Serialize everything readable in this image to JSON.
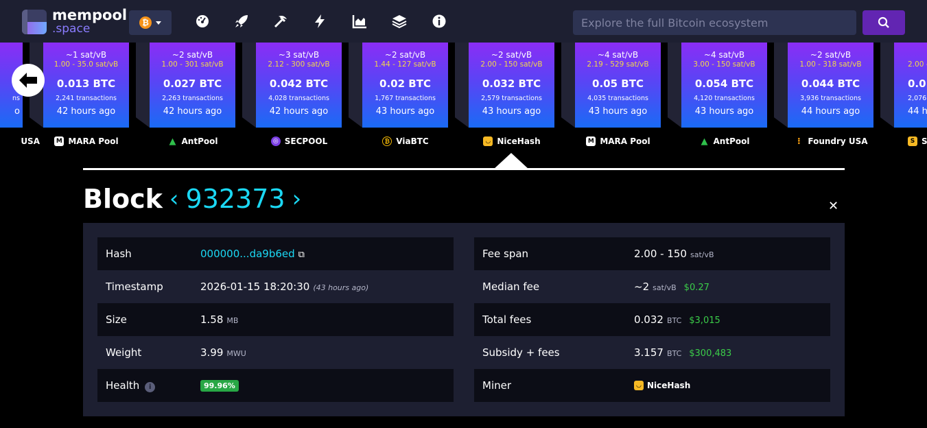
{
  "header": {
    "logo_top": "mempool",
    "logo_bottom": ".space",
    "network_symbol": "₿",
    "search_placeholder": "Explore the full Bitcoin ecosystem",
    "nav_icons": [
      "dashboard-icon",
      "rocket-icon",
      "mining-icon",
      "lightning-icon",
      "graphs-icon",
      "docs-icon",
      "about-icon"
    ]
  },
  "blocks": [
    {
      "fee": "~1 sat/vB",
      "range": "1.00 - 35.0 sat/vB",
      "amount": "0.013 BTC",
      "txs": "2,241 transactions",
      "time": "42 hours ago",
      "pool": "MARA Pool"
    },
    {
      "fee": "~2 sat/vB",
      "range": "1.00 - 301 sat/vB",
      "amount": "0.027 BTC",
      "txs": "2,263 transactions",
      "time": "42 hours ago",
      "pool": "AntPool"
    },
    {
      "fee": "~3 sat/vB",
      "range": "2.12 - 300 sat/vB",
      "amount": "0.042 BTC",
      "txs": "4,028 transactions",
      "time": "42 hours ago",
      "pool": "SECPOOL"
    },
    {
      "fee": "~2 sat/vB",
      "range": "1.44 - 127 sat/vB",
      "amount": "0.02 BTC",
      "txs": "1,767 transactions",
      "time": "43 hours ago",
      "pool": "ViaBTC"
    },
    {
      "fee": "~2 sat/vB",
      "range": "2.00 - 150 sat/vB",
      "amount": "0.032 BTC",
      "txs": "2,579 transactions",
      "time": "43 hours ago",
      "pool": "NiceHash"
    },
    {
      "fee": "~4 sat/vB",
      "range": "2.19 - 529 sat/vB",
      "amount": "0.05 BTC",
      "txs": "4,035 transactions",
      "time": "43 hours ago",
      "pool": "MARA Pool"
    },
    {
      "fee": "~4 sat/vB",
      "range": "3.00 - 150 sat/vB",
      "amount": "0.054 BTC",
      "txs": "4,120 transactions",
      "time": "43 hours ago",
      "pool": "AntPool"
    },
    {
      "fee": "~2 sat/vB",
      "range": "1.00 - 318 sat/vB",
      "amount": "0.044 BTC",
      "txs": "3,936 transactions",
      "time": "44 hours ago",
      "pool": "Foundry USA"
    }
  ],
  "partial_left": {
    "amount": "C",
    "txs": "ns",
    "time": "o",
    "pool": "USA"
  },
  "partial_right": {
    "range": "2.00 -",
    "amount": "0.0",
    "txs": "2,076",
    "time": "44 h",
    "pool": "S"
  },
  "block_title": {
    "word": "Block",
    "prev": "‹",
    "number": "932373",
    "next": "›",
    "close": "✕"
  },
  "details_left": [
    {
      "key": "Hash",
      "value": "000000...da9b6ed",
      "extra": "⧉"
    },
    {
      "key": "Timestamp",
      "value": "2026-01-15 18:20:30",
      "note": "(43 hours ago)"
    },
    {
      "key": "Size",
      "value": "1.58",
      "unit": "MB"
    },
    {
      "key": "Weight",
      "value": "3.99",
      "unit": "MWU"
    },
    {
      "key": "Health",
      "info": "i",
      "badge": "99.96%"
    }
  ],
  "details_right": [
    {
      "key": "Fee span",
      "value": "2.00 - 150",
      "unit": "sat/vB"
    },
    {
      "key": "Median fee",
      "value": "~2",
      "unit": "sat/vB",
      "fiat": "$0.27"
    },
    {
      "key": "Total fees",
      "value": "0.032",
      "unit": "BTC",
      "fiat": "$3,015"
    },
    {
      "key": "Subsidy + fees",
      "value": "3.157",
      "unit": "BTC",
      "fiat": "$300,483"
    },
    {
      "key": "Miner",
      "value": "NiceHash"
    }
  ],
  "colors": {
    "header_bg": "#1d1f31",
    "panel_bg": "#1d1f31",
    "accent": "#1bd8f4",
    "search_button": "#6225b2",
    "fiat_green": "#3bcc49",
    "health_badge": "#28a745"
  }
}
